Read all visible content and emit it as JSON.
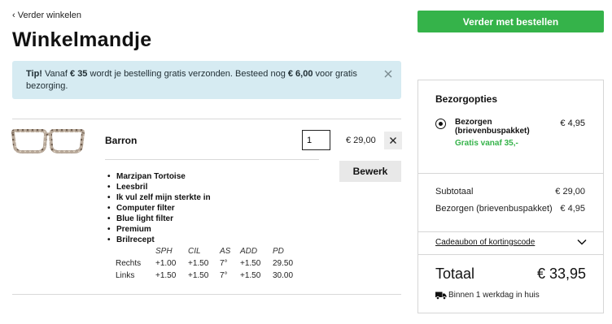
{
  "nav": {
    "back_label": "‹ Verder winkelen"
  },
  "page": {
    "title": "Winkelmandje"
  },
  "tip": {
    "lead": "Tip!",
    "text1": " Vanaf ",
    "amount1": "€ 35",
    "text2": " wordt je bestelling gratis verzonden. Besteed nog ",
    "amount2": "€ 6,00",
    "text3": " voor gratis bezorging."
  },
  "cart": {
    "item": {
      "name": "Barron",
      "quantity": "1",
      "price": "€ 29,00",
      "edit_label": "Bewerk",
      "options": [
        "Marzipan Tortoise",
        "Leesbril",
        "Ik vul zelf mijn sterkte in",
        "Computer filter",
        "Blue light filter",
        "Premium",
        "Brilrecept"
      ],
      "prescription": {
        "headers": [
          "",
          "SPH",
          "CIL",
          "AS",
          "ADD",
          "PD"
        ],
        "rows": [
          [
            "Rechts",
            "+1.00",
            "+1.50",
            "7°",
            "+1.50",
            "29.50"
          ],
          [
            "Links",
            "+1.50",
            "+1.50",
            "7°",
            "+1.50",
            "30.00"
          ]
        ]
      }
    }
  },
  "checkout": {
    "button_label": "Verder met bestellen"
  },
  "summary": {
    "title": "Bezorgopties",
    "shipping": {
      "label": "Bezorgen (brievenbuspakket)",
      "price": "€ 4,95",
      "free_note": "Gratis vanaf 35,-"
    },
    "subtotal_label": "Subtotaal",
    "subtotal_value": "€ 29,00",
    "delivery_label": "Bezorgen (brievenbuspakket)",
    "delivery_value": "€ 4,95",
    "coupon_label": "Cadeaubon of kortingscode",
    "total_label": "Totaal",
    "total_value": "€ 33,95",
    "delivery_time": "Binnen 1 werkdag in huis"
  },
  "colors": {
    "accent": "#35b34a",
    "tip_bg": "#d6ebf2"
  }
}
